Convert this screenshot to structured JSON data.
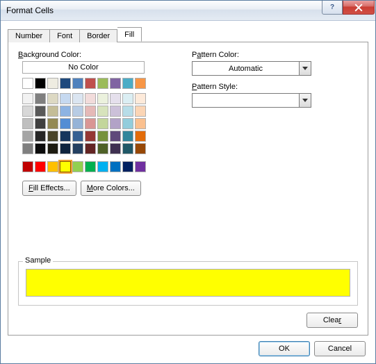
{
  "window": {
    "title": "Format Cells"
  },
  "tabs": {
    "number": "Number",
    "font": "Font",
    "border": "Border",
    "fill": "Fill"
  },
  "fill": {
    "bg_label": "Background Color:",
    "no_color": "No Color",
    "fill_effects": "Fill Effects...",
    "more_colors": "More Colors...",
    "pattern_color_label": "Pattern Color:",
    "pattern_color_value": "Automatic",
    "pattern_style_label": "Pattern Style:",
    "pattern_style_value": ""
  },
  "sample": {
    "label": "Sample",
    "color": "#ffff00"
  },
  "buttons": {
    "clear": "Clear",
    "ok": "OK",
    "cancel": "Cancel"
  },
  "palette": {
    "theme_row": [
      "#ffffff",
      "#000000",
      "#eeece1",
      "#1f497d",
      "#4f81bd",
      "#c0504d",
      "#9bbb59",
      "#8064a2",
      "#4bacc6",
      "#f79646"
    ],
    "tints": [
      [
        "#f2f2f2",
        "#7f7f7f",
        "#ddd9c3",
        "#c6d9f0",
        "#dbe5f1",
        "#f2dcdb",
        "#ebf1dd",
        "#e5e0ec",
        "#dbeef3",
        "#fdeada"
      ],
      [
        "#d8d8d8",
        "#595959",
        "#c4bd97",
        "#8db3e2",
        "#b8cce4",
        "#e5b9b7",
        "#d7e3bc",
        "#ccc1d9",
        "#b7dde8",
        "#fbd5b5"
      ],
      [
        "#bfbfbf",
        "#3f3f3f",
        "#938953",
        "#548dd4",
        "#95b3d7",
        "#d99694",
        "#c3d69b",
        "#b2a2c7",
        "#92cddc",
        "#fac08f"
      ],
      [
        "#a5a5a5",
        "#262626",
        "#494429",
        "#17365d",
        "#366092",
        "#953734",
        "#76923c",
        "#5f497a",
        "#31859b",
        "#e36c09"
      ],
      [
        "#7f7f7f",
        "#0c0c0c",
        "#1d1b10",
        "#0f243e",
        "#244061",
        "#632423",
        "#4f6128",
        "#3f3151",
        "#205867",
        "#974806"
      ]
    ],
    "standard": [
      "#c00000",
      "#ff0000",
      "#ffc000",
      "#ffff00",
      "#92d050",
      "#00b050",
      "#00b0f0",
      "#0070c0",
      "#002060",
      "#7030a0"
    ],
    "selected": "#ffff00"
  }
}
